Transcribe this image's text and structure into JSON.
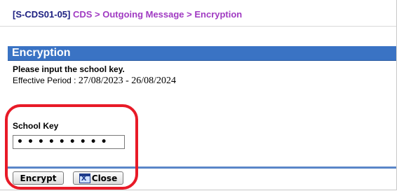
{
  "breadcrumb": {
    "code": "[S-CDS01-05]",
    "path": "CDS > Outgoing Message > Encryption"
  },
  "section": {
    "title": "Encryption"
  },
  "instructions": {
    "prompt": "Please input the school key.",
    "period_label": "Effective Period : ",
    "period_value": "27/08/2023 - 26/08/2024"
  },
  "form": {
    "school_key_label": "School Key",
    "school_key_value": "•••••••••"
  },
  "buttons": {
    "encrypt_label": "Encrypt",
    "close_label": "Close"
  },
  "colors": {
    "header_bg": "#3a73c4",
    "breadcrumb_code": "#1b1e80",
    "breadcrumb_path": "#a03ac2",
    "highlight": "#e81a27"
  },
  "icons": {
    "close": "close-window-icon"
  }
}
